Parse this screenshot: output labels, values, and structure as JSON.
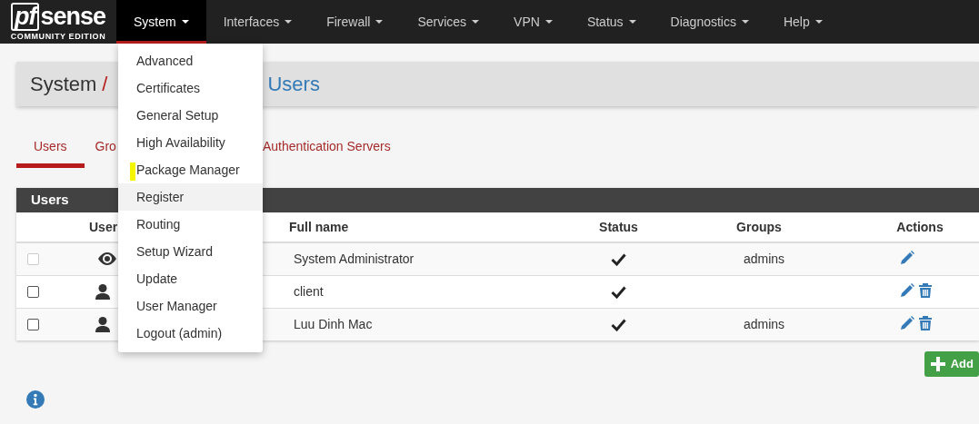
{
  "navbar": {
    "logo": {
      "prefix": "pf",
      "name": "sense",
      "edition": "COMMUNITY EDITION"
    },
    "menus": [
      {
        "label": "System",
        "selected": true
      },
      {
        "label": "Interfaces",
        "selected": false
      },
      {
        "label": "Firewall",
        "selected": false
      },
      {
        "label": "Services",
        "selected": false
      },
      {
        "label": "VPN",
        "selected": false
      },
      {
        "label": "Status",
        "selected": false
      },
      {
        "label": "Diagnostics",
        "selected": false
      },
      {
        "label": "Help",
        "selected": false
      }
    ]
  },
  "dropdown": {
    "items": [
      {
        "label": "Advanced",
        "hovered": false,
        "highlighted": false
      },
      {
        "label": "Certificates",
        "hovered": false,
        "highlighted": false
      },
      {
        "label": "General Setup",
        "hovered": false,
        "highlighted": false
      },
      {
        "label": "High Availability",
        "hovered": false,
        "highlighted": false
      },
      {
        "label": "Package Manager",
        "hovered": false,
        "highlighted": true
      },
      {
        "label": "Register",
        "hovered": true,
        "highlighted": false
      },
      {
        "label": "Routing",
        "hovered": false,
        "highlighted": false
      },
      {
        "label": "Setup Wizard",
        "hovered": false,
        "highlighted": false
      },
      {
        "label": "Update",
        "hovered": false,
        "highlighted": false
      },
      {
        "label": "User Manager",
        "hovered": false,
        "highlighted": false
      },
      {
        "label": "Logout (admin)",
        "hovered": false,
        "highlighted": false
      }
    ]
  },
  "breadcrumb": {
    "section": "System",
    "separator": "/",
    "current": "Users"
  },
  "tabs": [
    {
      "label": "Users",
      "selected": true
    },
    {
      "label": "Gro",
      "selected": false
    },
    {
      "label": "Authentication Servers",
      "selected": false
    }
  ],
  "panel": {
    "title": "Users",
    "columns": [
      "User",
      "Full name",
      "Status",
      "Groups",
      "Actions"
    ],
    "rows": [
      {
        "checked": false,
        "disabled": true,
        "kind": "system",
        "full_name": "System Administrator",
        "enabled": true,
        "groups": "admins",
        "deletable": false
      },
      {
        "checked": false,
        "disabled": false,
        "kind": "user",
        "full_name": "client",
        "enabled": true,
        "deletable": true
      },
      {
        "checked": false,
        "disabled": false,
        "kind": "user",
        "full_name": "Luu Dinh Mac",
        "enabled": true,
        "groups": "admins",
        "deletable": true
      }
    ]
  },
  "add_button": {
    "label": "Add"
  }
}
